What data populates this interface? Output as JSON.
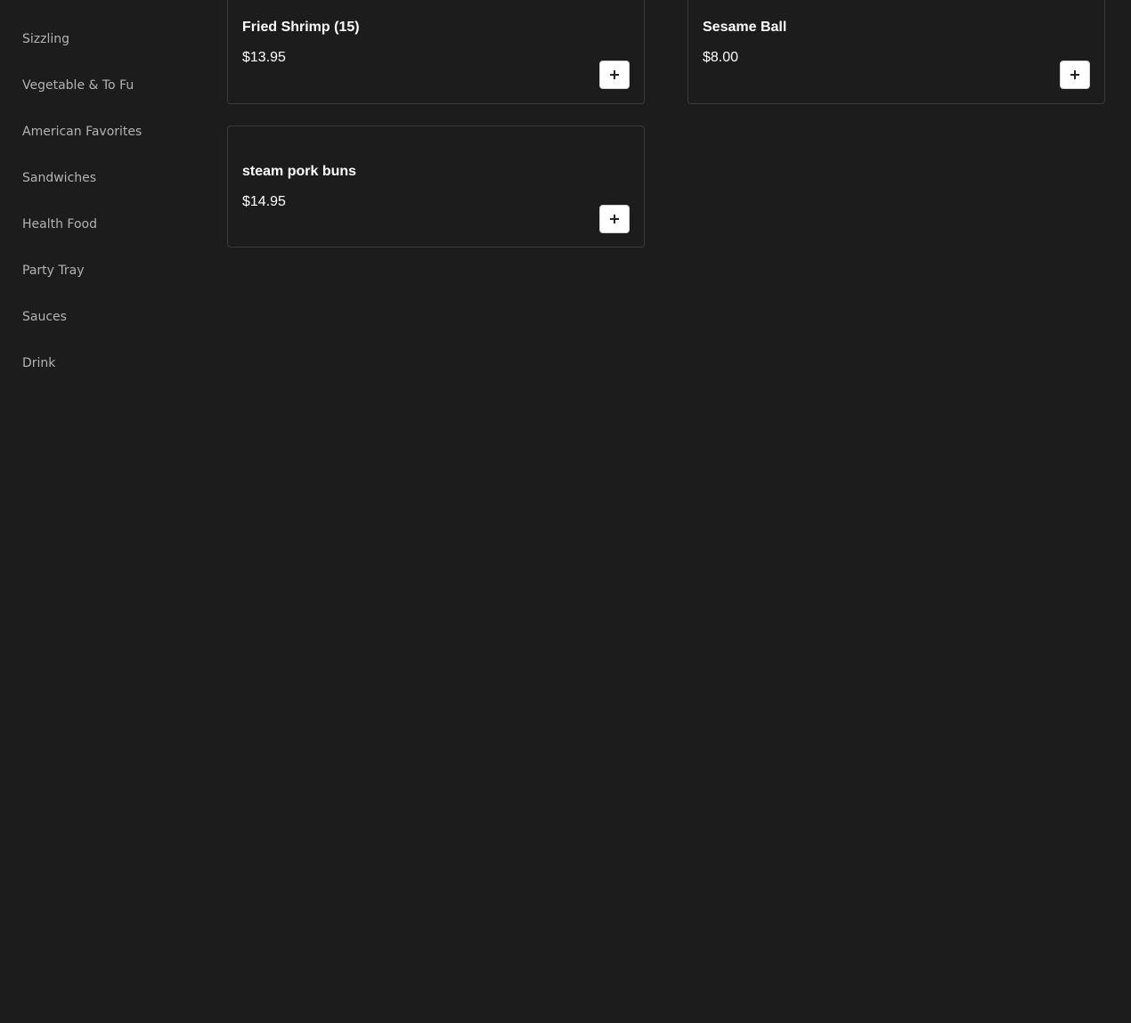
{
  "sidebar": {
    "items": [
      {
        "label": "Sizzling"
      },
      {
        "label": "Vegetable & To Fu"
      },
      {
        "label": "American Favorites"
      },
      {
        "label": "Sandwiches"
      },
      {
        "label": "Health Food"
      },
      {
        "label": "Party Tray"
      },
      {
        "label": "Sauces"
      },
      {
        "label": "Drink"
      }
    ]
  },
  "menu_items": [
    {
      "name": "Fried Shrimp (15)",
      "price": "$13.95"
    },
    {
      "name": "Sesame Ball",
      "price": "$8.00"
    },
    {
      "name": "steam pork buns",
      "price": "$14.95"
    }
  ],
  "colors": {
    "background": "#1c1c1c",
    "card_border": "#3a3a3a",
    "sidebar_text": "#b3b3b3",
    "card_text": "#ffffff",
    "add_button_bg": "#ffffff"
  }
}
